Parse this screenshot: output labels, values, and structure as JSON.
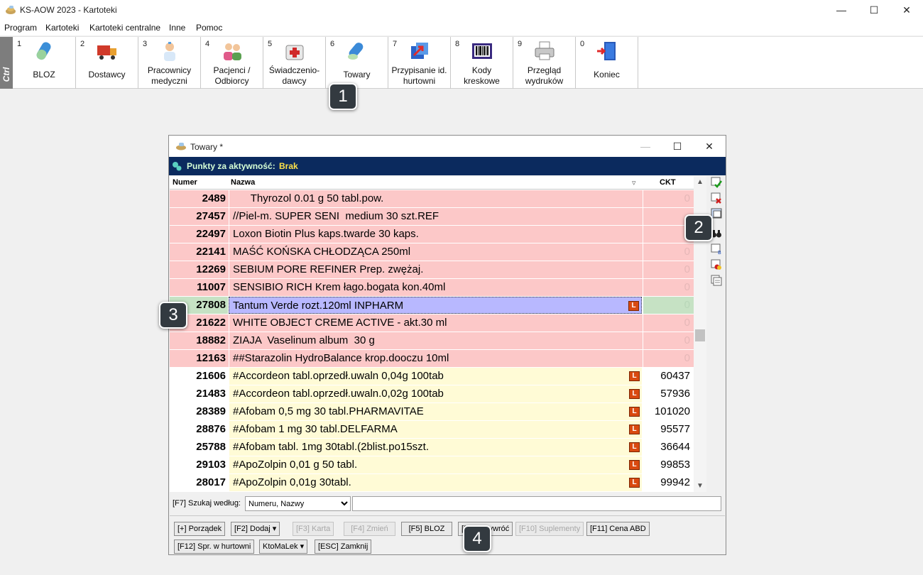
{
  "window": {
    "title": "KS-AOW 2023 - Kartoteki",
    "minimize": "—",
    "maximize": "☐",
    "close": "✕"
  },
  "menu": [
    "Program",
    "Kartoteki",
    "Kartoteki centralne",
    "Inne",
    "Pomoc"
  ],
  "ctrl_label": "Ctrl",
  "toolbar": [
    {
      "num": "1",
      "label": "BLOZ",
      "icon": "bloz-pill-icon"
    },
    {
      "num": "2",
      "label": "Dostawcy",
      "icon": "truck-icon"
    },
    {
      "num": "3",
      "label": "Pracownicy\nmedyczni",
      "icon": "doctor-icon"
    },
    {
      "num": "4",
      "label": "Pacjenci /\nOdbiorcy",
      "icon": "patients-icon"
    },
    {
      "num": "5",
      "label": "Świadczenio-\ndawcy",
      "icon": "first-aid-kit-icon"
    },
    {
      "num": "6",
      "label": "Towary",
      "icon": "pills-icon"
    },
    {
      "num": "7",
      "label": "Przypisanie id.\nhurtowni",
      "icon": "assign-arrow-icon"
    },
    {
      "num": "8",
      "label": "Kody\nkreskowe",
      "icon": "barcode-icon"
    },
    {
      "num": "9",
      "label": "Przegląd\nwydruków",
      "icon": "printer-icon"
    },
    {
      "num": "0",
      "label": "Koniec",
      "icon": "exit-door-icon"
    }
  ],
  "child": {
    "title": "Towary *",
    "minimize": "—",
    "maximize": "☐",
    "close": "✕",
    "points_label": "Punkty za aktywność:",
    "points_value": "Brak",
    "columns": {
      "num": "Numer",
      "name": "Nazwa",
      "ckt": "CKT",
      "sort_indicator": "▿"
    },
    "rows": [
      {
        "num": "2489",
        "name": "      Thyrozol 0.01 g 50 tabl.pow.",
        "ckt": "0",
        "style": "red",
        "badge": ""
      },
      {
        "num": "27457",
        "name": "//Piel-m. SUPER SENI  medium 30 szt.REF",
        "ckt": "",
        "style": "red",
        "badge": ""
      },
      {
        "num": "22497",
        "name": "Loxon Biotin Plus kaps.twarde 30 kaps.",
        "ckt": "",
        "style": "red",
        "badge": ""
      },
      {
        "num": "22141",
        "name": "MAŚĆ KOŃSKA CHŁODZĄCA 250ml",
        "ckt": "0",
        "style": "red",
        "badge": ""
      },
      {
        "num": "12269",
        "name": "SEBIUM PORE REFINER Prep. zwężaj.",
        "ckt": "0",
        "style": "red",
        "badge": ""
      },
      {
        "num": "11007",
        "name": "SENSIBIO RICH Krem łago.bogata kon.40ml",
        "ckt": "0",
        "style": "red",
        "badge": ""
      },
      {
        "num": "27808",
        "name": "Tantum Verde rozt.120ml INPHARM",
        "ckt": "0",
        "style": "sel",
        "badge": "L"
      },
      {
        "num": "21622",
        "name": "WHITE OBJECT CREME ACTIVE - akt.30 ml",
        "ckt": "0",
        "style": "red",
        "badge": ""
      },
      {
        "num": "18882",
        "name": "ZIAJA  Vaselinum album  30 g",
        "ckt": "0",
        "style": "red",
        "badge": ""
      },
      {
        "num": "12163",
        "name": "##Starazolin HydroBalance krop.dooczu 10ml",
        "ckt": "0",
        "style": "red",
        "badge": ""
      },
      {
        "num": "21606",
        "name": "#Accordeon tabl.oprzedł.uwaln 0,04g 100tab",
        "ckt": "60437",
        "style": "yel",
        "badge": "L"
      },
      {
        "num": "21483",
        "name": "#Accordeon tabl.oprzedł.uwaln.0,02g 100tab",
        "ckt": "57936",
        "style": "yel",
        "badge": "L"
      },
      {
        "num": "28389",
        "name": "#Afobam 0,5 mg 30 tabl.PHARMAVITAE",
        "ckt": "101020",
        "style": "yel",
        "badge": "L"
      },
      {
        "num": "28876",
        "name": "#Afobam 1 mg 30 tabl.DELFARMA",
        "ckt": "95577",
        "style": "yel",
        "badge": "L"
      },
      {
        "num": "25788",
        "name": "#Afobam tabl. 1mg 30tabl.(2blist.po15szt.",
        "ckt": "36644",
        "style": "yel",
        "badge": "L"
      },
      {
        "num": "29103",
        "name": "#ApoZolpin 0,01 g 50 tabl.",
        "ckt": "99853",
        "style": "yel",
        "badge": "L"
      },
      {
        "num": "28017",
        "name": "#ApoZolpin 0,01g 30tabl.",
        "ckt": "99942",
        "style": "yel",
        "badge": "L"
      }
    ],
    "search": {
      "label": "[F7] Szukaj według:",
      "selected": "Numeru, Nazwy",
      "value": ""
    },
    "buttons": {
      "order": "[+] Porządek",
      "add": "[F2] Dodaj ▾",
      "card": "[F3] Karta",
      "change": "[F4] Zmień",
      "bloz": "[F5] BLOZ",
      "restore": "[F8] Przywróć",
      "supplements": "[F10] Suplementy",
      "price": "[F11] Cena ABD",
      "wholesale": "[F12] Spr. w hurtowni",
      "ktomalek": "KtoMaLek ▾",
      "close": "[ESC] Zamknij"
    }
  },
  "callouts": [
    "1",
    "2",
    "3",
    "4"
  ]
}
